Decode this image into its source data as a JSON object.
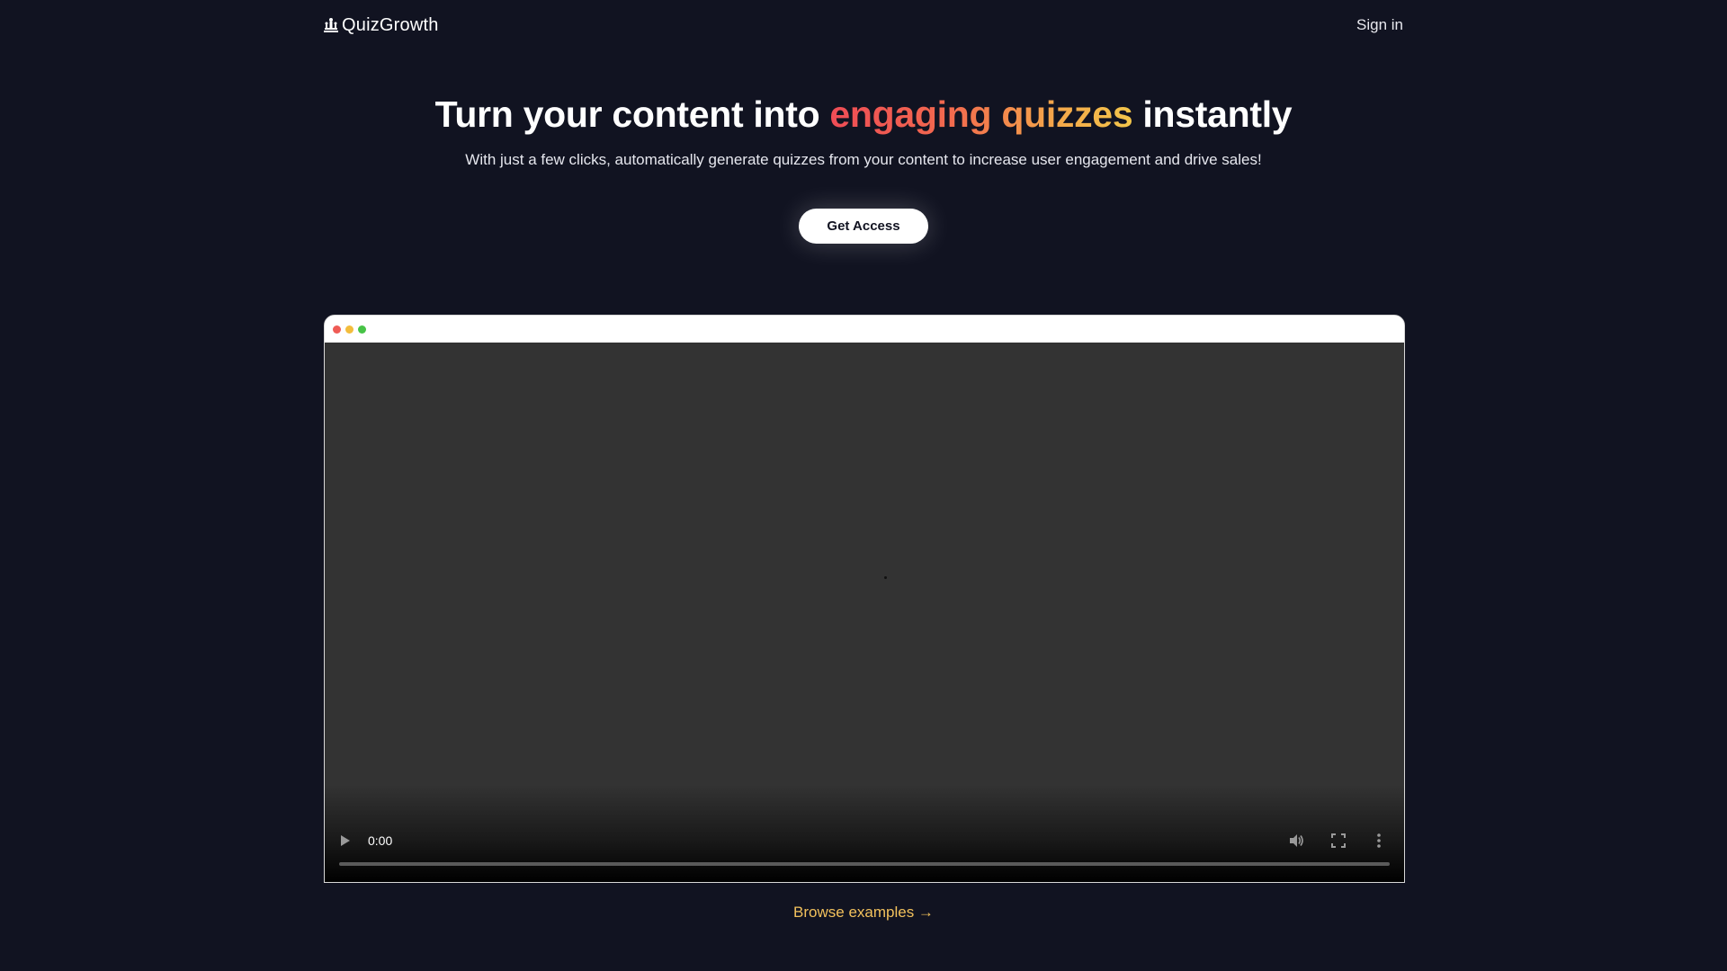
{
  "header": {
    "logo_text": "QuizGrowth",
    "logo_icon": "chess-pieces-icon",
    "signin_label": "Sign in"
  },
  "hero": {
    "title_before": "Turn your content into ",
    "title_highlight": "engaging quizzes",
    "title_after": " instantly",
    "subtitle": "With just a few clicks, automatically generate quizzes from your content to increase user engagement and drive sales!",
    "cta_label": "Get Access"
  },
  "video": {
    "time": "0:00",
    "progress": 0,
    "icons": [
      "play-icon",
      "volume-icon",
      "fullscreen-icon",
      "more-options-icon"
    ]
  },
  "footer_link": {
    "label": "Browse examples →"
  },
  "colors": {
    "background": "#111321",
    "gradient_start": "#ef4c56",
    "gradient_end": "#f3c64b",
    "link": "#f2c15c",
    "window_dot_red": "#ef5b55",
    "window_dot_yellow": "#f3bd3c",
    "window_dot_green": "#47c346"
  }
}
